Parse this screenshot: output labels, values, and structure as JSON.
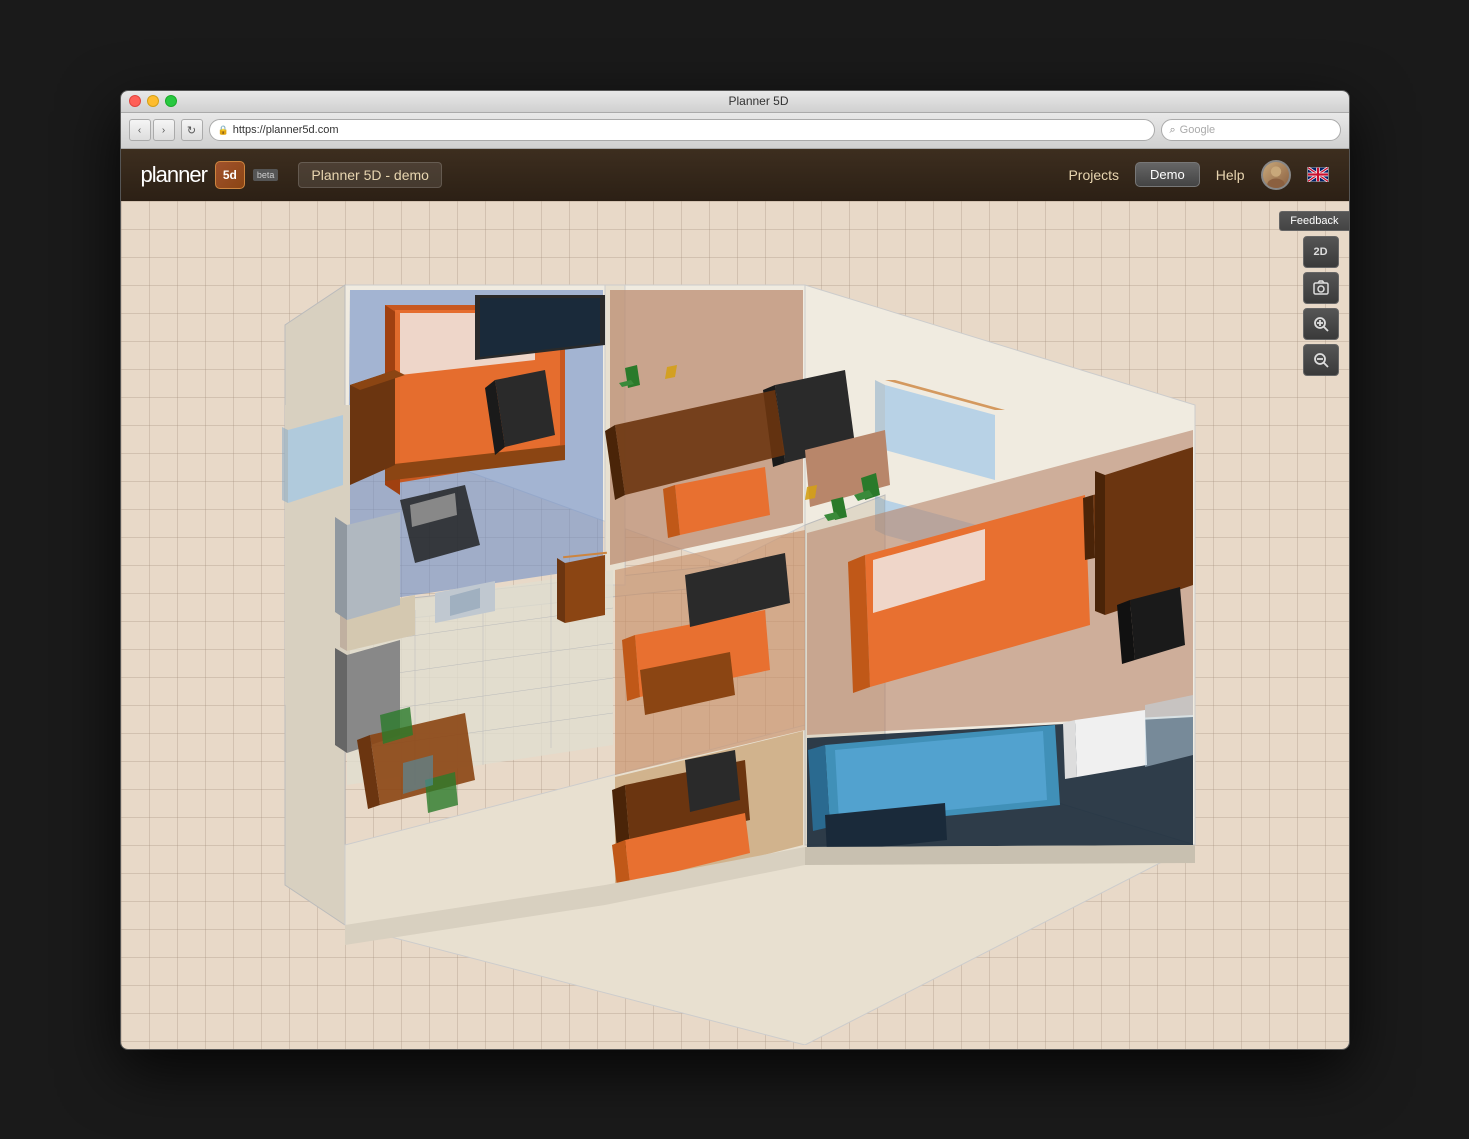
{
  "window": {
    "title": "Planner 5D",
    "traffic_lights": [
      "close",
      "minimize",
      "maximize"
    ]
  },
  "browser": {
    "url": "https://planner5d.com",
    "search_placeholder": "Google",
    "back_label": "‹",
    "forward_label": "›",
    "refresh_label": "↻"
  },
  "header": {
    "logo_text": "planner",
    "logo_box": "5d",
    "beta_label": "beta",
    "project_name": "Planner 5D - demo",
    "nav_items": [
      "Projects",
      "Demo",
      "Help"
    ],
    "demo_label": "Demo",
    "flag_label": "🇬🇧"
  },
  "toolbar": {
    "feedback_label": "Feedback",
    "view_2d_label": "2D",
    "screenshot_label": "📷",
    "zoom_in_label": "+",
    "zoom_out_label": "-"
  },
  "canvas": {
    "background_color": "#e8d9c8",
    "grid_color": "rgba(160,140,120,0.3)"
  }
}
